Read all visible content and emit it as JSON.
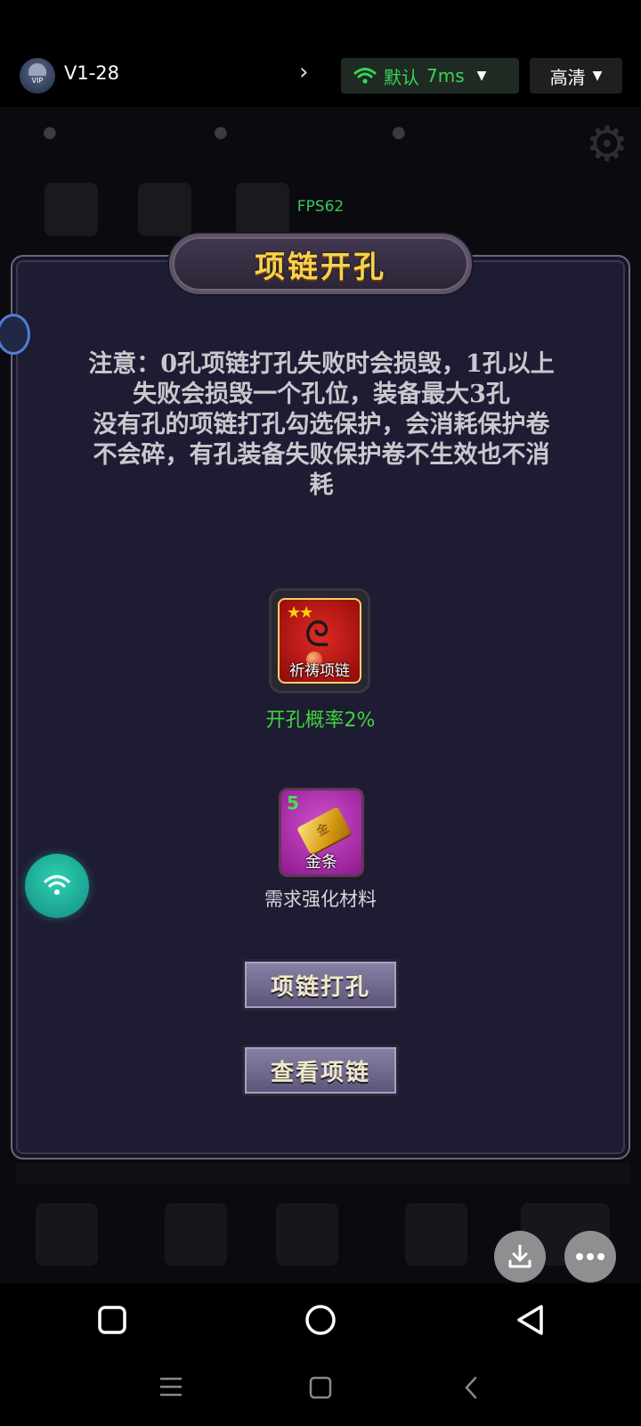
{
  "topbar": {
    "vip_label": "VIP",
    "room_name": "V1-28",
    "network": {
      "label": "默认",
      "latency": "7ms"
    },
    "quality": "高清"
  },
  "background": {
    "fps": "FPS62"
  },
  "dialog": {
    "title": "项链开孔",
    "notice_lines": [
      "注意：0孔项链打孔失败时会损毁，1孔以上",
      "失败会损毁一个孔位，装备最大3孔",
      "没有孔的项链打孔勾选保护，会消耗保护卷",
      "不会碎，有孔装备失败保护卷不生效也不消",
      "耗"
    ],
    "item": {
      "name": "祈祷项链",
      "stars": "★★",
      "chance": "开孔概率2%"
    },
    "material": {
      "name": "金条",
      "count": "5",
      "glyph": "金",
      "caption": "需求强化材料"
    },
    "buttons": {
      "punch": "项链打孔",
      "view": "查看项链"
    }
  },
  "colors": {
    "title_gold": "#f7d24a",
    "chance_green": "#3fd43c",
    "net_green": "#38d65a",
    "dialog_bg": "#1e1c32"
  },
  "icons": {
    "wifi_float": "wifi-icon",
    "download": "download-icon",
    "more": "more-icon"
  }
}
